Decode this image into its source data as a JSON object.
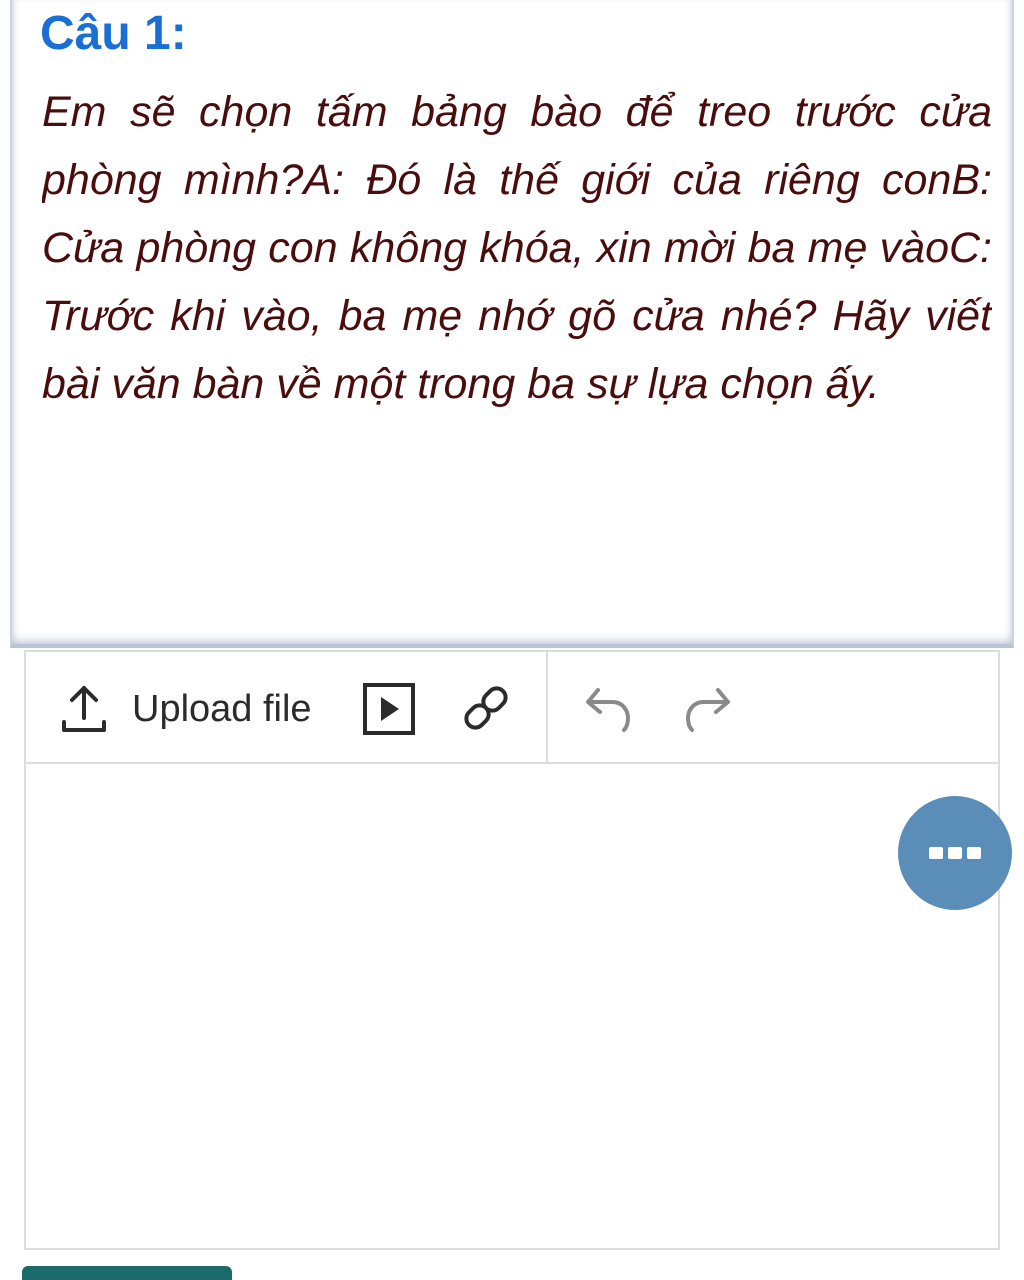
{
  "question": {
    "title": "Câu 1:",
    "text": "Em sẽ chọn tấm bảng bào để treo trước cửa phòng mình?A: Đó là thế giới của riêng conB: Cửa phòng con không khóa, xin mời ba mẹ vàoC: Trước khi vào, ba mẹ nhớ gõ cửa nhé? Hãy viết bài văn bàn về một trong ba sự lựa chọn ấy."
  },
  "toolbar": {
    "upload_label": "Upload file",
    "icons": {
      "upload": "upload-icon",
      "video": "video-play-icon",
      "link": "link-icon",
      "undo": "undo-icon",
      "redo": "redo-icon",
      "more": "more-icon"
    }
  },
  "colors": {
    "title": "#1a6fd4",
    "question_text": "#4a0d0d",
    "more_button": "#5a8db8",
    "submit_button": "#1b6b6a",
    "hint": "#c62828"
  }
}
